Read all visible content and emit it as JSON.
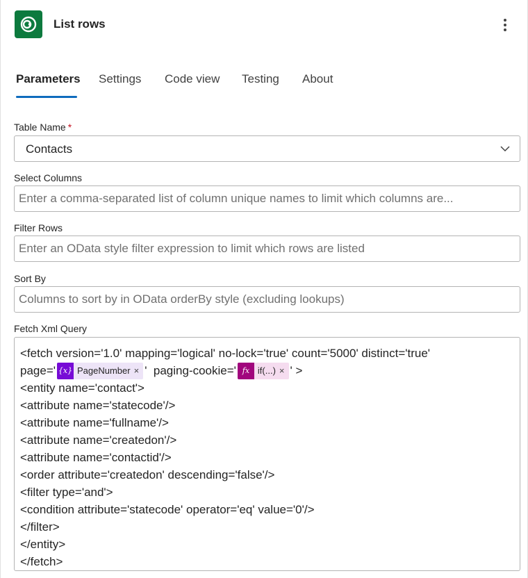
{
  "header": {
    "title": "List rows",
    "more_icon": "more-vertical-icon"
  },
  "tabs": [
    {
      "label": "Parameters",
      "active": true
    },
    {
      "label": "Settings",
      "active": false
    },
    {
      "label": "Code view",
      "active": false
    },
    {
      "label": "Testing",
      "active": false
    },
    {
      "label": "About",
      "active": false
    }
  ],
  "fields": {
    "table_name": {
      "label": "Table Name",
      "required_mark": "*",
      "value": "Contacts"
    },
    "select_columns": {
      "label": "Select Columns",
      "placeholder": "Enter a comma-separated list of column unique names to limit which columns are..."
    },
    "filter_rows": {
      "label": "Filter Rows",
      "placeholder": "Enter an OData style filter expression to limit which rows are listed"
    },
    "sort_by": {
      "label": "Sort By",
      "placeholder": "Columns to sort by in OData orderBy style (excluding lookups)"
    },
    "fetch_xml": {
      "label": "Fetch Xml Query",
      "line1": "<fetch version='1.0' mapping='logical' no-lock='true' count='5000' distinct='true'",
      "line2_prefix": "page='",
      "token_page": {
        "icon_text": "{x}",
        "label": "PageNumber",
        "remove": "×"
      },
      "line2_middle": "'  paging-cookie='",
      "token_cookie": {
        "icon_text": "fx",
        "label": "if(...)",
        "remove": "×"
      },
      "line2_suffix": "' >",
      "lines": [
        "<entity name='contact'>",
        "<attribute name='statecode'/>",
        "<attribute name='fullname'/>",
        "<attribute name='createdon'/>",
        "<attribute name='contactid'/>",
        "<order attribute='createdon' descending='false'/>",
        "<filter type='and'>",
        "<condition attribute='statecode' operator='eq' value='0'/>",
        "</filter>",
        "</entity>",
        "</fetch>"
      ]
    }
  },
  "colors": {
    "brand": "#0d7a3e",
    "accent": "#0f6cbd",
    "variable_token": "#770bd6",
    "expression_token": "#a1067d"
  }
}
